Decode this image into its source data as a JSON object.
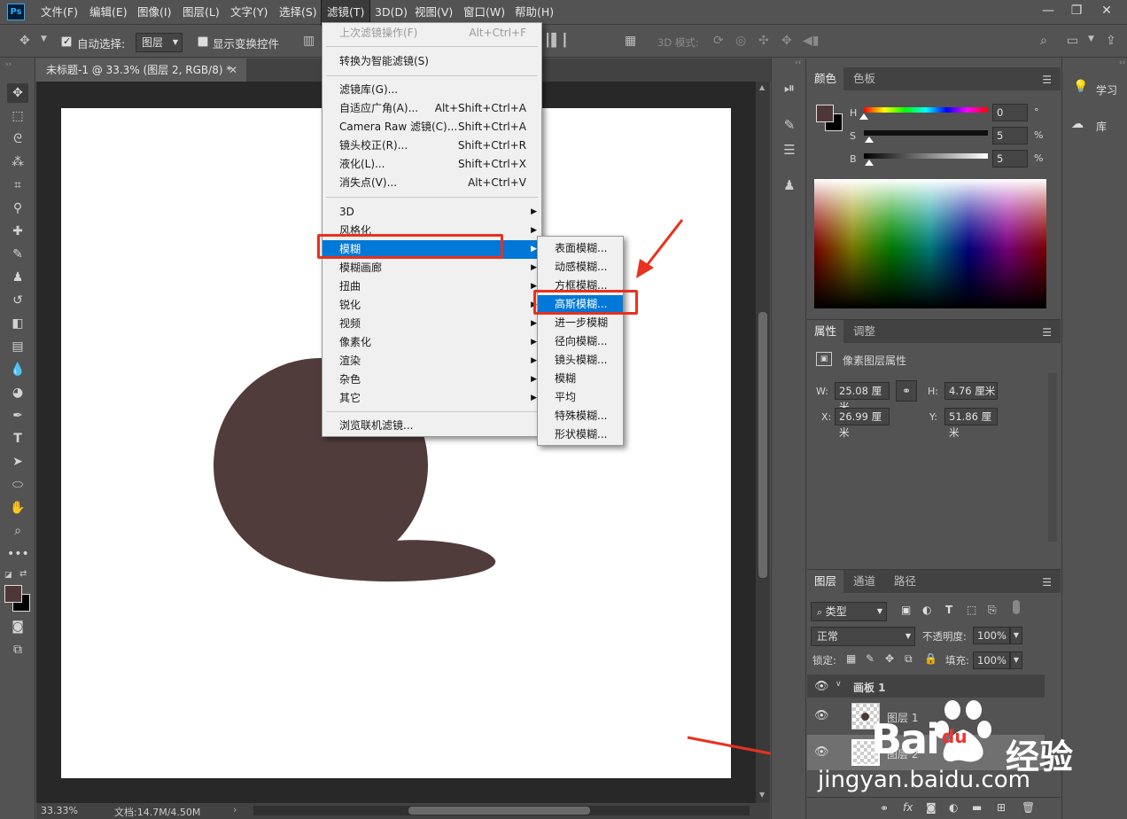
{
  "app": {
    "logo": "Ps"
  },
  "menubar": {
    "items": [
      "文件(F)",
      "编辑(E)",
      "图像(I)",
      "图层(L)",
      "文字(Y)",
      "选择(S)",
      "滤镜(T)",
      "3D(D)",
      "视图(V)",
      "窗口(W)",
      "帮助(H)"
    ],
    "active_index": 6
  },
  "options": {
    "auto_select_label": "自动选择:",
    "auto_select_checked": true,
    "auto_select_target": "图层",
    "show_transform_label": "显示变换控件",
    "show_transform_checked": false,
    "mode_3d_label": "3D 模式:"
  },
  "document": {
    "tab_title": "未标题-1 @ 33.3% (图层 2, RGB/8) *",
    "shape_color": "#513c3c"
  },
  "status": {
    "zoom": "33.33%",
    "doc_info": "文档:14.7M/4.50M"
  },
  "filter_menu": {
    "last_filter": {
      "label": "上次滤镜操作(F)",
      "shortcut": "Alt+Ctrl+F"
    },
    "convert_smart": "转换为智能滤镜(S)",
    "group1": [
      {
        "label": "滤镜库(G)...",
        "shortcut": ""
      },
      {
        "label": "自适应广角(A)...",
        "shortcut": "Alt+Shift+Ctrl+A"
      },
      {
        "label": "Camera Raw 滤镜(C)...",
        "shortcut": "Shift+Ctrl+A"
      },
      {
        "label": "镜头校正(R)...",
        "shortcut": "Shift+Ctrl+R"
      },
      {
        "label": "液化(L)...",
        "shortcut": "Shift+Ctrl+X"
      },
      {
        "label": "消失点(V)...",
        "shortcut": "Alt+Ctrl+V"
      }
    ],
    "submenus": [
      "3D",
      "风格化",
      "模糊",
      "模糊画廊",
      "扭曲",
      "锐化",
      "视频",
      "像素化",
      "渲染",
      "杂色",
      "其它"
    ],
    "highlighted_submenu_index": 2,
    "browse_online": "浏览联机滤镜..."
  },
  "blur_submenu": {
    "items": [
      "表面模糊...",
      "动感模糊...",
      "方框模糊...",
      "高斯模糊...",
      "进一步模糊",
      "径向模糊...",
      "镜头模糊...",
      "模糊",
      "平均",
      "特殊模糊...",
      "形状模糊..."
    ],
    "highlighted_index": 3
  },
  "color_panel": {
    "tabs": [
      "颜色",
      "色板"
    ],
    "foreground": "#4f3737",
    "background": "#000000",
    "h": {
      "label": "H",
      "value": "0",
      "unit": "°"
    },
    "s": {
      "label": "S",
      "value": "5",
      "unit": "%"
    },
    "b": {
      "label": "B",
      "value": "5",
      "unit": "%"
    }
  },
  "properties_panel": {
    "tabs": [
      "属性",
      "调整"
    ],
    "title": "像素图层属性",
    "w": {
      "label": "W:",
      "value": "25.08 厘米"
    },
    "h": {
      "label": "H:",
      "value": "4.76 厘米"
    },
    "x": {
      "label": "X:",
      "value": "26.99 厘米"
    },
    "y": {
      "label": "Y:",
      "value": "51.86 厘米"
    }
  },
  "layers_panel": {
    "tabs": [
      "图层",
      "通道",
      "路径"
    ],
    "filter_kind": "类型",
    "blend_mode": "正常",
    "opacity_label": "不透明度:",
    "opacity": "100%",
    "lock_label": "锁定:",
    "fill_label": "填充:",
    "fill": "100%",
    "artboard": "画板 1",
    "layers": [
      "图层 1",
      "图层 2"
    ]
  },
  "learn_dock": {
    "learn": "学习",
    "library": "库"
  },
  "watermark": {
    "brand": "Bai",
    "brand2": "du",
    "suffix": "经验",
    "url": "jingyan.baidu.com"
  }
}
